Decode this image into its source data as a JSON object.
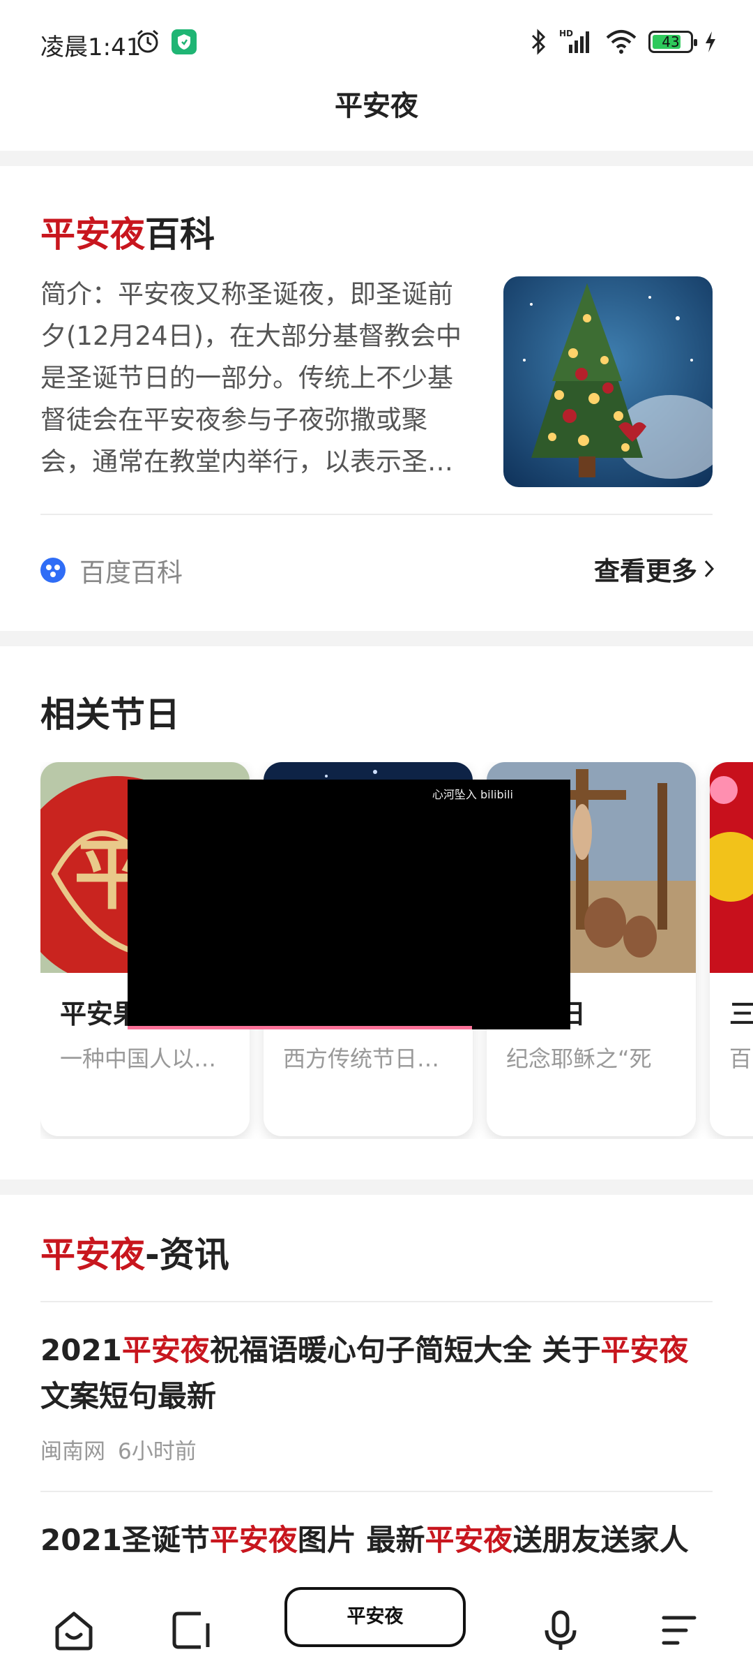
{
  "status_bar": {
    "time": "凌晨1:41",
    "signal_label": "HD",
    "battery": "43"
  },
  "header": {
    "title": "平安夜"
  },
  "baike": {
    "title_highlight": "平安夜",
    "title_suffix": "百科",
    "summary": "简介：平安夜又称圣诞夜，即圣诞前夕(12月24日)，在大部分基督教会中是圣诞节日的一部分。传统上不少基督徒会在平安夜参与子夜弥撒或聚会，通常在教堂内举行，以表示圣…",
    "source": "百度百科",
    "more_label": "查看更多"
  },
  "festivals": {
    "heading": "相关节日",
    "items": [
      {
        "name": "平安果",
        "desc": "一种中国人以…"
      },
      {
        "name": "",
        "desc": "西方传统节日…"
      },
      {
        "name": "受难日",
        "desc": "纪念耶稣之“死"
      },
      {
        "name": "三",
        "desc": "百"
      }
    ],
    "video_watermark": "心河坠入 bilibili"
  },
  "news": {
    "heading_highlight": "平安夜",
    "heading_suffix": "-资讯",
    "items": [
      {
        "segments": [
          "2021",
          "平安夜",
          "祝福语暖心句子简短大全 关于",
          "平安夜",
          "文案短句最新"
        ],
        "source": "闽南网",
        "time": "6小时前"
      },
      {
        "segments": [
          "2021圣诞节",
          "平安夜",
          "图片 最新",
          "平安夜",
          "送朋友送家人"
        ]
      }
    ]
  },
  "bottom_bar": {
    "search_query": "平安夜"
  },
  "colors": {
    "accent_red": "#c8161e",
    "bilibili_pink": "#fb7299"
  }
}
